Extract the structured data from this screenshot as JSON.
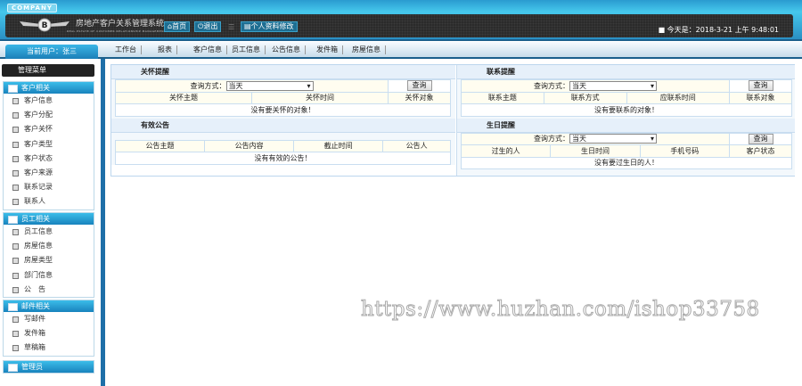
{
  "header": {
    "company": "COMPANY",
    "title": "房地产客户关系管理系统",
    "subtitle": "REAL ESTATE OF CUSTOMER RELATIONSHIP MANAGEMENT SYSTEM",
    "home": "首页",
    "logout": "退出",
    "profile": "个人资料修改",
    "date": "今天是：2018-3-21 上午 9:48:01"
  },
  "nav": {
    "user": "当前用户：张三",
    "items": [
      "工作台",
      "报表",
      "客户信息",
      "员工信息",
      "公告信息",
      "发件箱",
      "房屋信息"
    ]
  },
  "sidebar": {
    "title": "管理菜单",
    "groups": [
      {
        "label": "客户相关",
        "items": [
          "客户信息",
          "客户分配",
          "客户关怀",
          "客户类型",
          "客户状态",
          "客户来源",
          "联系记录",
          "联系人"
        ]
      },
      {
        "label": "员工相关",
        "items": [
          "员工信息",
          "房屋信息",
          "房屋类型",
          "部门信息",
          "公　告"
        ]
      },
      {
        "label": "邮件相关",
        "items": [
          "写邮件",
          "发件箱",
          "草稿箱"
        ]
      },
      {
        "label": "管理员",
        "items": []
      }
    ]
  },
  "panels": {
    "care": {
      "title": "关怀提醒",
      "query_label": "查询方式：",
      "select": "当天",
      "button": "查询",
      "cols": [
        "关怀主题",
        "关怀时间",
        "关怀对象"
      ],
      "empty": "没有要关怀的对象！"
    },
    "notice": {
      "title": "有效公告",
      "cols": [
        "公告主题",
        "公告内容",
        "截止时间",
        "公告人"
      ],
      "empty": "没有有效的公告！"
    },
    "contact": {
      "title": "联系提醒",
      "query_label": "查询方式：",
      "select": "当天",
      "button": "查询",
      "cols": [
        "联系主题",
        "联系方式",
        "应联系时间",
        "联系对象"
      ],
      "empty": "没有要联系的对象！"
    },
    "birthday": {
      "title": "生日提醒",
      "query_label": "查询方式：",
      "select": "当天",
      "button": "查询",
      "cols": [
        "过生的人",
        "生日时间",
        "手机号码",
        "客户状态"
      ],
      "empty": "没有要过生日的人！"
    }
  },
  "watermark": "https://www.huzhan.com/ishop33758"
}
